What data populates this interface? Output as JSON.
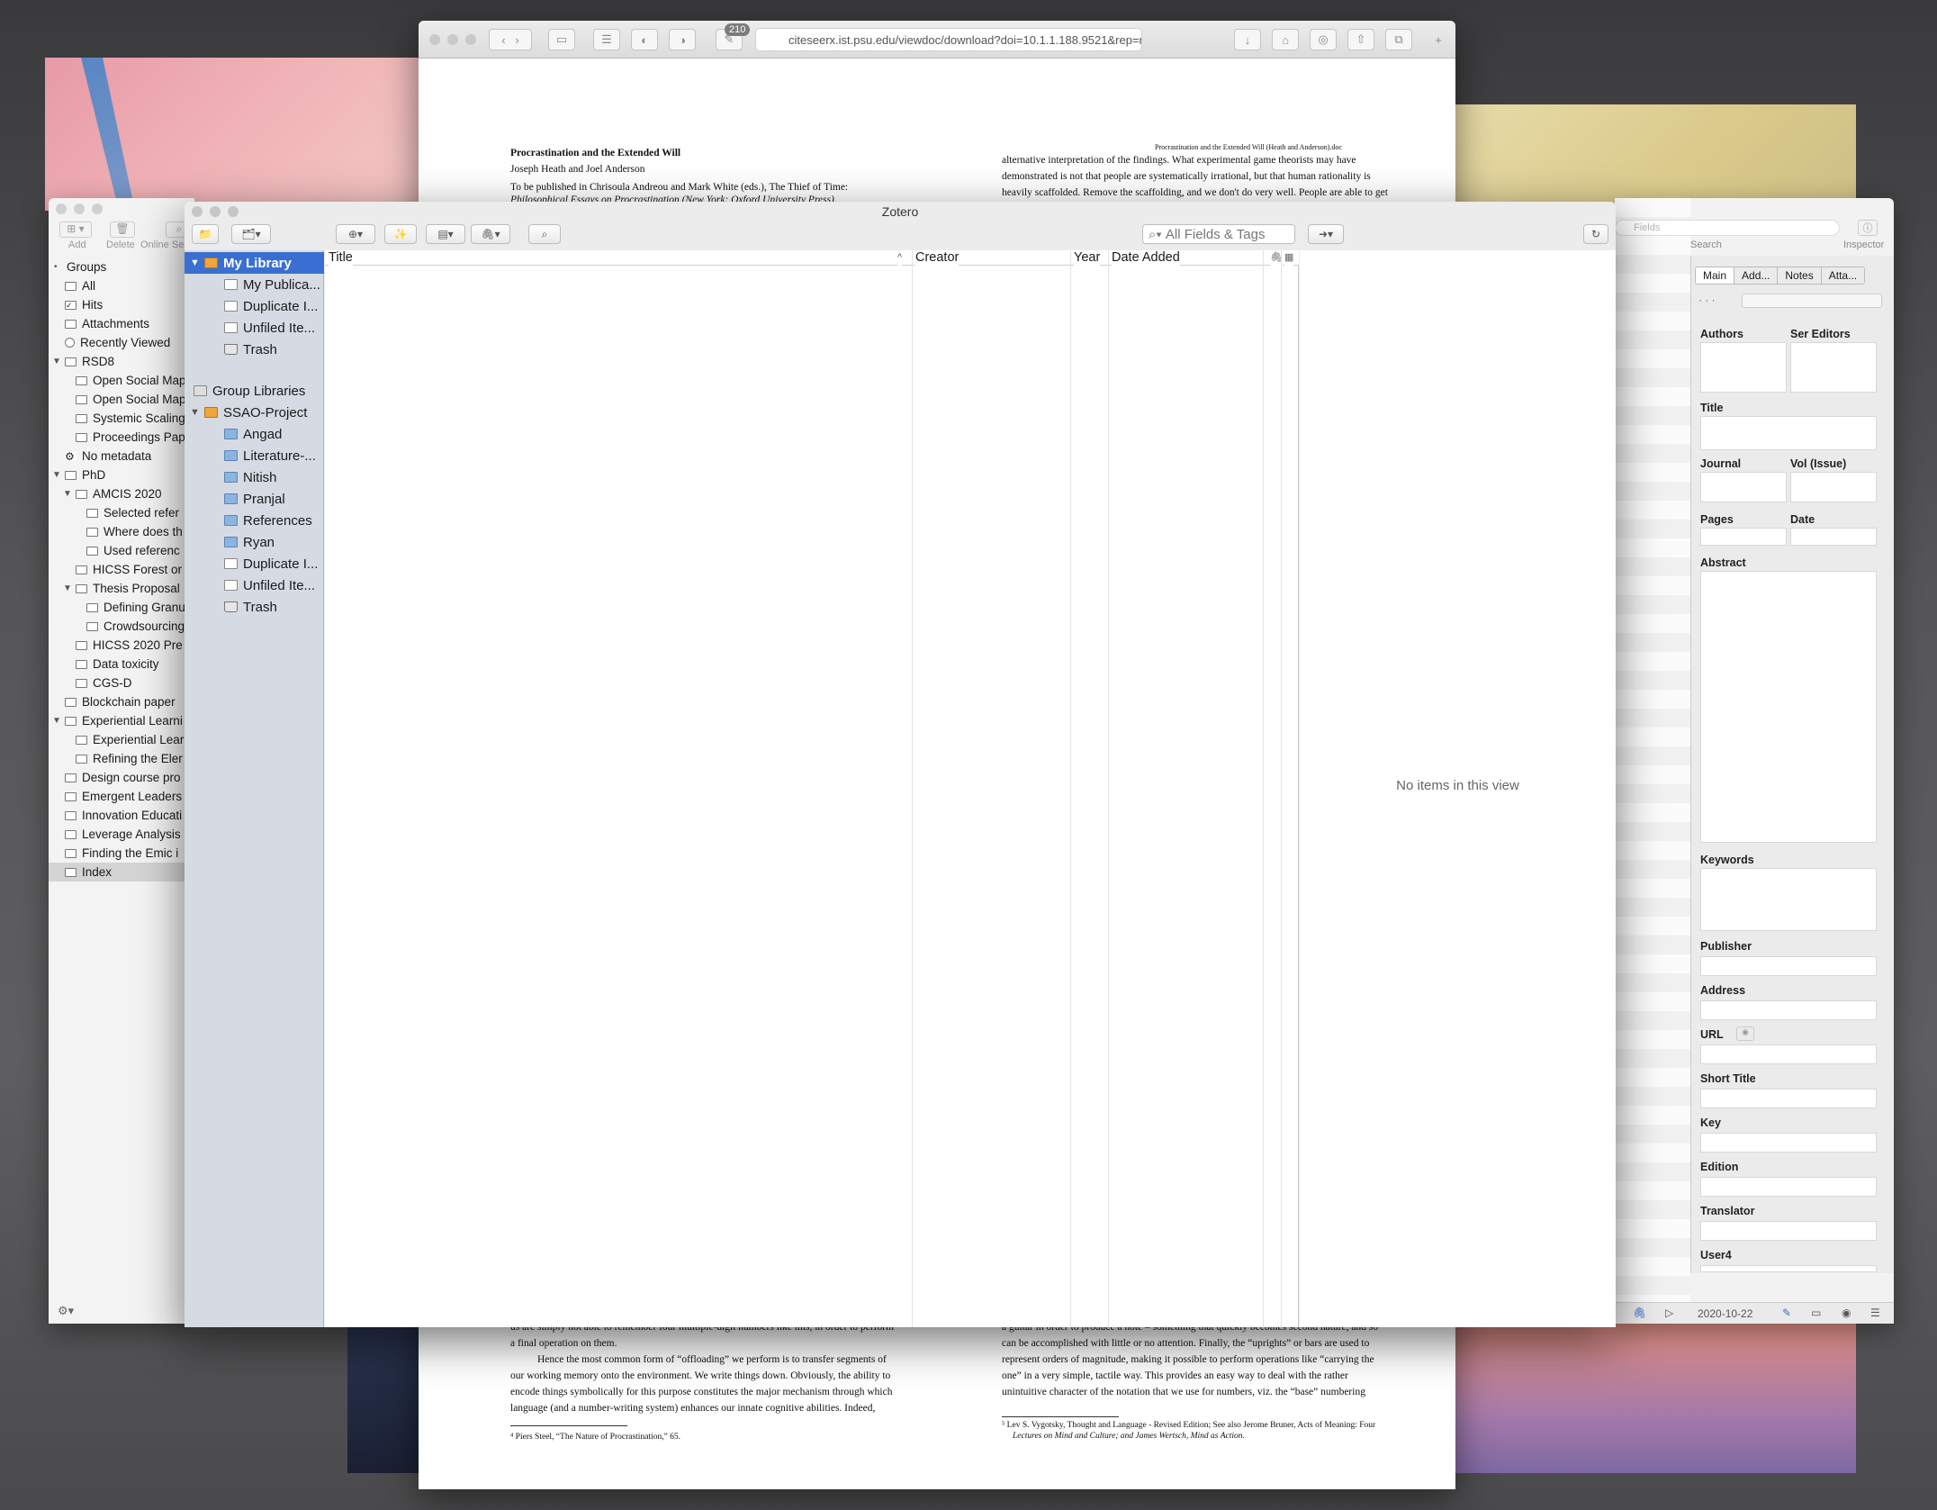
{
  "safari": {
    "url": "citeseerx.ist.psu.edu/viewdoc/download?doi=10.1.1.188.9521&rep=rep",
    "badge": "210"
  },
  "doc": {
    "title": "Procrastination and the Extended Will",
    "authors": "Joseph Heath and Joel Anderson",
    "pub1": "To be published in Chrisoula Andreou and Mark White (eds.), The Thief of Time:",
    "pub2": "Philosophical Essays on Procrastination (New York: Oxford University Press).",
    "header_right": "Procrastination and the Extended Will (Heath and Anderson).doc",
    "r1": "alternative interpretation of the findings. What experimental game theorists may have",
    "r2": "demonstrated is not that people are systematically irrational, but that human rationality is",
    "r3": "heavily scaffolded. Remove the scaffolding, and we don't do very well. People are able to get",
    "b1": "us are simply not able to remember four multiple-digit numbers like this, in order to perform",
    "b2": "a final operation on them.",
    "b3": "Hence the most common form of “offloading” we perform is to transfer segments of",
    "b4": "our working memory onto the environment. We write things down. Obviously, the ability to",
    "b5": "encode things symbolically for this purpose constitutes the major mechanism through which",
    "b6": "language (and a number-writing system) enhances our innate cognitive abilities. Indeed,",
    "fn1": "⁴ Piers Steel, “The Nature of Procrastination,” 65.",
    "br1": "a guitar in order to produce a note – something that quickly becomes second nature, and so",
    "br2": "can be accomplished with little or no attention. Finally, the “uprights” or bars are used to",
    "br3": "represent orders of magnitude, making it possible to perform operations like “carrying the",
    "br4": "one” in a very simple, tactile way. This provides an easy way to deal with the rather",
    "br5": "unintuitive character of the notation that we use for numbers, viz. the “base” numbering",
    "fn2": "⁵ Lev S. Vygotsky, Thought and Language - Revised Edition; See also Jerome Bruner, Acts of Meaning: Four",
    "fn3": "Lectures on Mind and Culture; and James Wertsch, Mind as Action."
  },
  "left_window": {
    "toolbar": {
      "add": "Add",
      "delete": "Delete",
      "online": "Online Se"
    },
    "groups_label": "Groups",
    "rows": [
      {
        "label": "All",
        "indent": 1,
        "icon": "doc"
      },
      {
        "label": "Hits",
        "indent": 1,
        "icon": "check"
      },
      {
        "label": "Attachments",
        "indent": 1,
        "icon": "clip"
      },
      {
        "label": "Recently Viewed",
        "indent": 1,
        "icon": "clock"
      },
      {
        "label": "RSD8",
        "indent": 1,
        "icon": "folder",
        "tri": "▼"
      },
      {
        "label": "Open Social Map",
        "indent": 2,
        "icon": "folder"
      },
      {
        "label": "Open Social Map",
        "indent": 2,
        "icon": "folder"
      },
      {
        "label": "Systemic Scaling",
        "indent": 2,
        "icon": "folder"
      },
      {
        "label": "Proceedings Pap",
        "indent": 2,
        "icon": "folder"
      },
      {
        "label": "No metadata",
        "indent": 1,
        "icon": "gear"
      },
      {
        "label": "PhD",
        "indent": 1,
        "icon": "folder",
        "tri": "▼"
      },
      {
        "label": "AMCIS 2020",
        "indent": 2,
        "icon": "folder",
        "tri": "▼"
      },
      {
        "label": "Selected refer",
        "indent": 3,
        "icon": "folder"
      },
      {
        "label": "Where does th",
        "indent": 3,
        "icon": "folder"
      },
      {
        "label": "Used referenc",
        "indent": 3,
        "icon": "folder"
      },
      {
        "label": "HICSS Forest or",
        "indent": 2,
        "icon": "folder"
      },
      {
        "label": "Thesis Proposal",
        "indent": 2,
        "icon": "folder",
        "tri": "▼"
      },
      {
        "label": "Defining Granu",
        "indent": 3,
        "icon": "folder"
      },
      {
        "label": "Crowdsourcing",
        "indent": 3,
        "icon": "folder"
      },
      {
        "label": "HICSS 2020 Pre",
        "indent": 2,
        "icon": "folder"
      },
      {
        "label": "Data toxicity",
        "indent": 2,
        "icon": "folder"
      },
      {
        "label": "CGS-D",
        "indent": 2,
        "icon": "folder"
      },
      {
        "label": "Blockchain paper",
        "indent": 1,
        "icon": "folder"
      },
      {
        "label": "Experiential Learni",
        "indent": 1,
        "icon": "folder",
        "tri": "▼"
      },
      {
        "label": "Experiential Lear",
        "indent": 2,
        "icon": "folder"
      },
      {
        "label": "Refining the Eler",
        "indent": 2,
        "icon": "folder"
      },
      {
        "label": "Design course pro",
        "indent": 1,
        "icon": "folder"
      },
      {
        "label": "Emergent Leaders",
        "indent": 1,
        "icon": "folder"
      },
      {
        "label": "Innovation Educati",
        "indent": 1,
        "icon": "folder"
      },
      {
        "label": "Leverage Analysis",
        "indent": 1,
        "icon": "folder"
      },
      {
        "label": "Finding the Emic i",
        "indent": 1,
        "icon": "folder"
      },
      {
        "label": "Index",
        "indent": 1,
        "icon": "folder",
        "selected": true
      }
    ]
  },
  "right_window": {
    "search_placeholder": "Fields",
    "search_label": "Search",
    "inspector_label": "Inspector",
    "tabs": [
      "Main",
      "Add...",
      "Notes",
      "Atta..."
    ],
    "dots": "· · ·",
    "labels": {
      "authors": "Authors",
      "editors": "Ser Editors",
      "title": "Title",
      "journal": "Journal",
      "vol": "Vol (Issue)",
      "pages": "Pages",
      "date": "Date",
      "abstract": "Abstract",
      "keywords": "Keywords",
      "publisher": "Publisher",
      "address": "Address",
      "url": "URL",
      "short_title": "Short Title",
      "key": "Key",
      "edition": "Edition",
      "translator": "Translator",
      "user4": "User4"
    },
    "status_date": "2020-10-22"
  },
  "zotero": {
    "title": "Zotero",
    "search_placeholder": "All Fields & Tags",
    "columns": {
      "title": "Title",
      "creator": "Creator",
      "year": "Year",
      "date_added": "Date Added"
    },
    "empty_message": "No items in this view",
    "library": [
      {
        "label": "My Library",
        "icon": "lib",
        "indent": 0,
        "selected": true,
        "tri": "▼"
      },
      {
        "label": "My Publica...",
        "icon": "doc",
        "indent": 1
      },
      {
        "label": "Duplicate I...",
        "icon": "doc",
        "indent": 1
      },
      {
        "label": "Unfiled Ite...",
        "icon": "doc",
        "indent": 1
      },
      {
        "label": "Trash",
        "icon": "trash",
        "indent": 1
      }
    ],
    "group_libraries_label": "Group Libraries",
    "groups": [
      {
        "label": "SSAO-Project",
        "icon": "lib",
        "indent": 0,
        "tri": "▼"
      },
      {
        "label": "Angad",
        "icon": "folder",
        "indent": 1
      },
      {
        "label": "Literature-...",
        "icon": "folder",
        "indent": 1
      },
      {
        "label": "Nitish",
        "icon": "folder",
        "indent": 1
      },
      {
        "label": "Pranjal",
        "icon": "folder",
        "indent": 1
      },
      {
        "label": "References",
        "icon": "folder",
        "indent": 1
      },
      {
        "label": "Ryan",
        "icon": "folder",
        "indent": 1
      },
      {
        "label": "Duplicate I...",
        "icon": "doc",
        "indent": 1
      },
      {
        "label": "Unfiled Ite...",
        "icon": "doc",
        "indent": 1
      },
      {
        "label": "Trash",
        "icon": "trash",
        "indent": 1
      }
    ]
  }
}
